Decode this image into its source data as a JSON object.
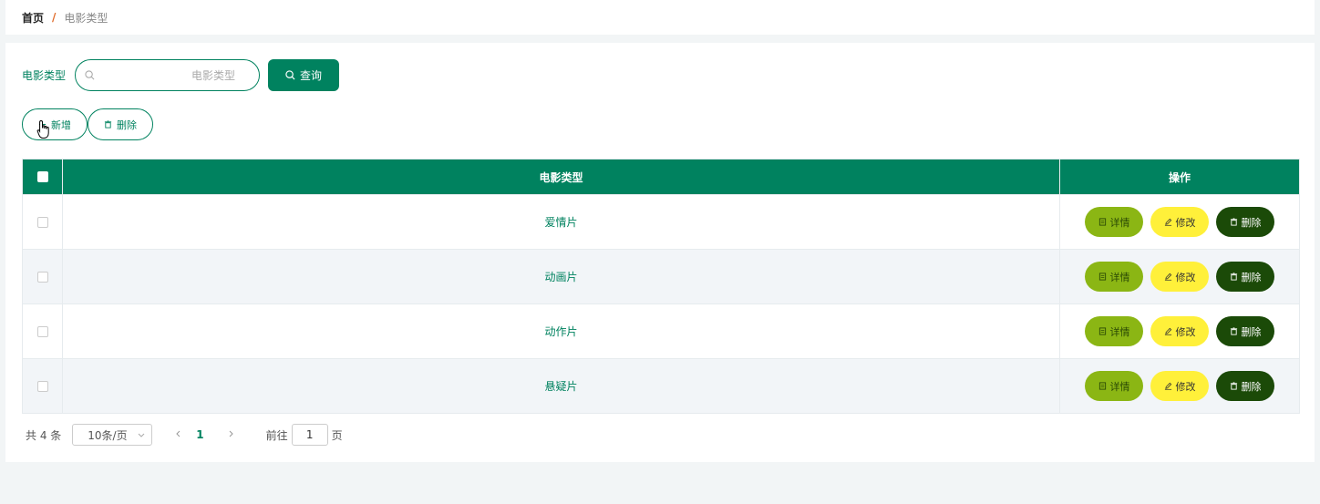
{
  "breadcrumb": {
    "home": "首页",
    "separator": "/",
    "current": "电影类型"
  },
  "search": {
    "label": "电影类型",
    "placeholder": "电影类型",
    "value": "",
    "button_label": "查询"
  },
  "actions": {
    "add_label": "新增",
    "delete_label": "删除"
  },
  "table": {
    "headers": {
      "type": "电影类型",
      "ops": "操作"
    },
    "rows": [
      {
        "type": "爱情片"
      },
      {
        "type": "动画片"
      },
      {
        "type": "动作片"
      },
      {
        "type": "悬疑片"
      }
    ],
    "op_labels": {
      "detail": "详情",
      "edit": "修改",
      "delete": "删除"
    }
  },
  "pager": {
    "total": "共 4 条",
    "page_size": "10条/页",
    "current_page": "1",
    "goto_label": "前往",
    "goto_value": "1",
    "page_suffix": "页"
  },
  "colors": {
    "primary": "#00825f",
    "detail": "#8bb614",
    "edit": "#fff03a",
    "delete": "#1b4a08",
    "breadcrumb_separator": "#e06b2a"
  }
}
